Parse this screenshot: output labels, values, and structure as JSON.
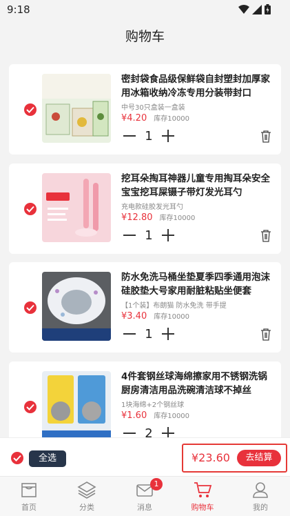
{
  "status": {
    "time": "9:18"
  },
  "header": {
    "title": "购物车"
  },
  "colors": {
    "accent": "#e8313b",
    "select_all_bg": "#27354a"
  },
  "cart": {
    "items": [
      {
        "title": "密封袋食品级保鲜袋自封塑封加厚家用冰箱收纳冷冻专用分装带封口",
        "spec": "中号30只盒装一盒装",
        "price": "¥4.20",
        "stock": "库存10000",
        "qty": "1",
        "image_icon": "sealed-bag-product-image",
        "image_caption": "密封防漏 锁住新鲜"
      },
      {
        "title": "挖耳朵掏耳神器儿童专用掏耳朵安全宝宝挖耳屎镊子带灯发光耳勺",
        "spec": "充电款硅胶发光耳勺",
        "price": "¥12.80",
        "stock": "库存10000",
        "qty": "1",
        "image_icon": "ear-pick-product-image",
        "image_caption": "不伤耳道"
      },
      {
        "title": "防水免洗马桶坐垫夏季四季通用泡沫硅胶垫大号家用耐脏粘贴坐便套",
        "spec": "【1个装】布朗猫 防水免洗 带手提",
        "price": "¥3.40",
        "stock": "库存10000",
        "qty": "1",
        "image_icon": "toilet-seat-product-image",
        "image_caption": "防水免洗 一擦即净"
      },
      {
        "title": "4件套钢丝球海绵擦家用不锈钢洗锅厨房清洁用品洗碗清洁球不掉丝",
        "spec": "1块海绵+2个钢丝球",
        "price": "¥1.60",
        "stock": "库存10000",
        "qty": "2",
        "image_icon": "steel-wool-product-image",
        "image_caption": "厨房清洁套装 4件套"
      }
    ]
  },
  "checkout": {
    "select_all": "全选",
    "total": "¥23.60",
    "button": "去结算"
  },
  "tabs": [
    {
      "label": "首页",
      "icon": "home-icon"
    },
    {
      "label": "分类",
      "icon": "layers-icon"
    },
    {
      "label": "消息",
      "icon": "mail-icon",
      "badge": "1"
    },
    {
      "label": "购物车",
      "icon": "cart-icon",
      "active": true
    },
    {
      "label": "我的",
      "icon": "user-icon"
    }
  ]
}
